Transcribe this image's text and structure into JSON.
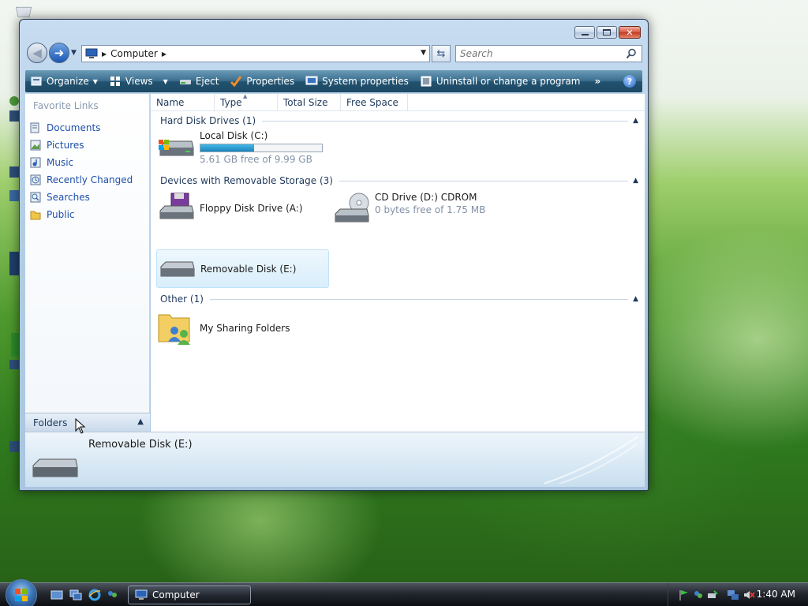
{
  "window": {
    "address": {
      "crumb": "Computer"
    },
    "search": {
      "placeholder": "Search"
    }
  },
  "toolbar": {
    "organize": "Organize",
    "views": "Views",
    "eject": "Eject",
    "properties": "Properties",
    "system_properties": "System properties",
    "uninstall": "Uninstall or change a program",
    "more": "»",
    "help": "?"
  },
  "nav": {
    "header": "Favorite Links",
    "items": [
      {
        "label": "Documents",
        "icon": "documents-icon"
      },
      {
        "label": "Pictures",
        "icon": "pictures-icon"
      },
      {
        "label": "Music",
        "icon": "music-icon"
      },
      {
        "label": "Recently Changed",
        "icon": "recently-changed-icon"
      },
      {
        "label": "Searches",
        "icon": "searches-icon"
      },
      {
        "label": "Public",
        "icon": "public-folder-icon"
      }
    ],
    "folders": "Folders"
  },
  "columns": [
    "Name",
    "Type",
    "Total Size",
    "Free Space"
  ],
  "groups": {
    "hdd": "Hard Disk Drives (1)",
    "removable": "Devices with Removable Storage (3)",
    "other": "Other (1)"
  },
  "drives": {
    "c": {
      "name": "Local Disk (C:)",
      "free": "5.61 GB free of 9.99 GB",
      "used_fraction": 0.44
    },
    "a": {
      "name": "Floppy Disk Drive (A:)"
    },
    "d": {
      "name": "CD Drive (D:) CDROM",
      "free": "0 bytes free of 1.75 MB"
    },
    "e": {
      "name": "Removable Disk (E:)"
    },
    "sharing": {
      "name": "My Sharing Folders"
    }
  },
  "details": {
    "name": "Removable Disk (E:)"
  },
  "taskbar": {
    "task_label": "Computer",
    "clock": "1:40 AM"
  },
  "colors": {
    "toolbar": "#2a5a78",
    "link": "#1f4fa8",
    "capacity_fill": "#1b86be"
  }
}
